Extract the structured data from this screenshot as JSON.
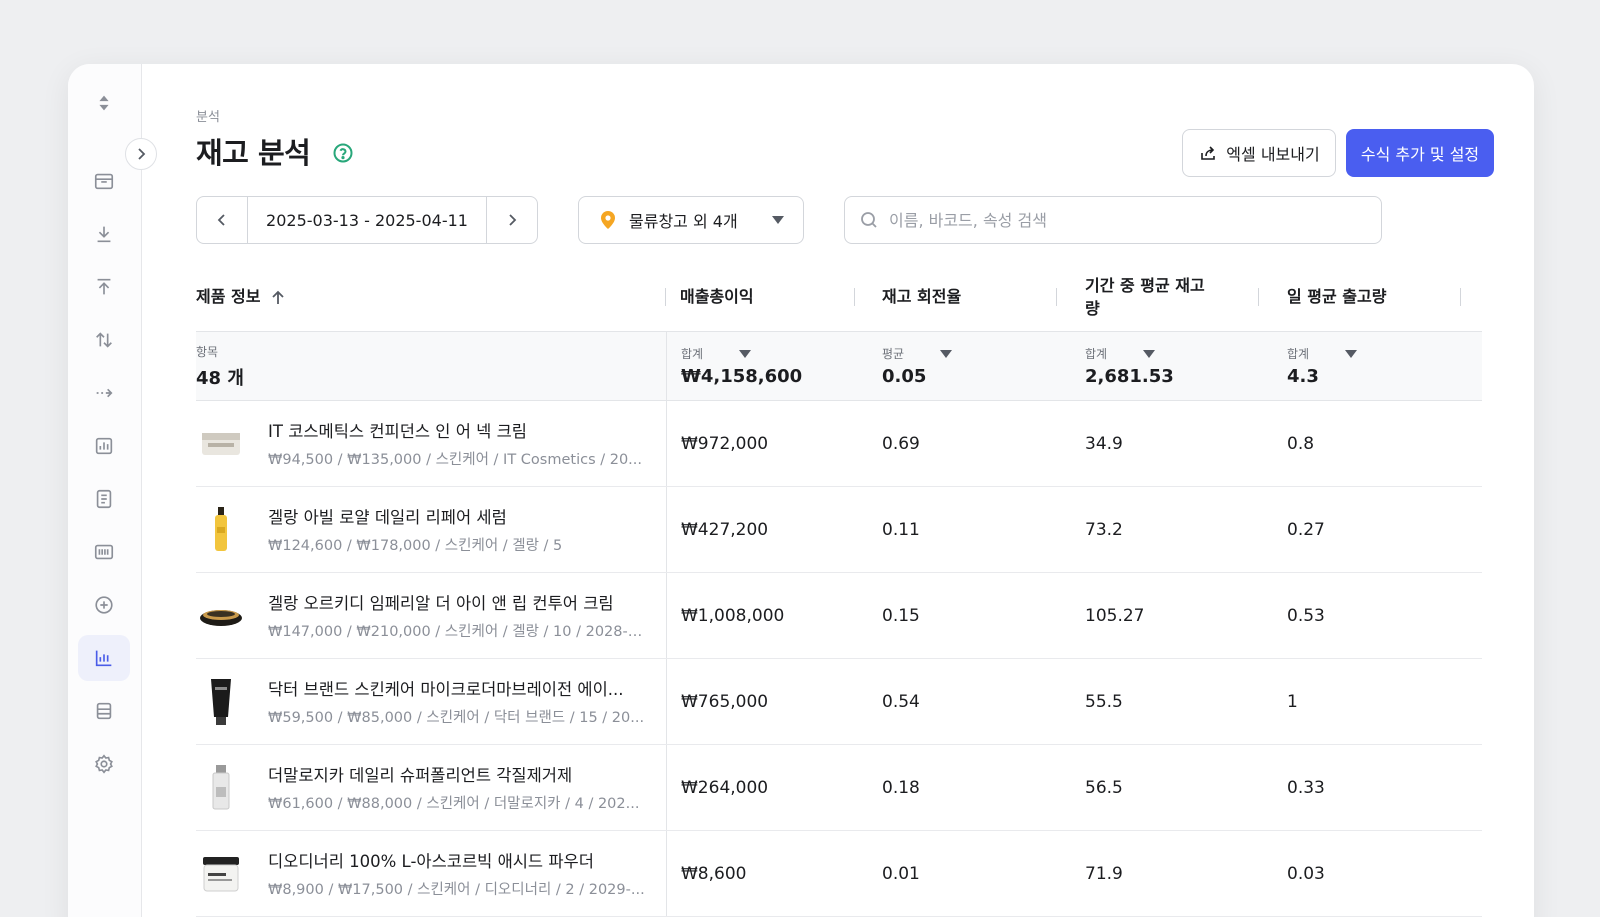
{
  "breadcrumb": "분석",
  "title": "재고 분석",
  "buttons": {
    "export": "엑셀 내보내기",
    "formula": "수식 추가 및 설정"
  },
  "filters": {
    "date_range": "2025-03-13 - 2025-04-11",
    "warehouse": "물류창고 외 4개",
    "search_placeholder": "이름, 바코드, 속성 검색"
  },
  "columns": [
    "제품 정보",
    "매출총이익",
    "재고 회전율",
    "기간 중 평균 재고량",
    "일 평균 출고량"
  ],
  "summary": {
    "items_label": "항목",
    "items_value": "48 개",
    "cells": [
      {
        "label": "합계",
        "value": "₩4,158,600"
      },
      {
        "label": "평균",
        "value": "0.05"
      },
      {
        "label": "합계",
        "value": "2,681.53"
      },
      {
        "label": "합계",
        "value": "4.3"
      }
    ]
  },
  "rows": [
    {
      "name": "IT 코스메틱스 컨피던스 인 어 넥 크림",
      "meta": "₩94,500 / ₩135,000 / 스킨케어 / IT Cosmetics / 20...",
      "profit": "₩972,000",
      "turnover": "0.69",
      "avg_stock": "34.9",
      "daily_out": "0.8"
    },
    {
      "name": "겔랑 아빌 로얄 데일리 리페어 세럼",
      "meta": "₩124,600 / ₩178,000 / 스킨케어 / 겔랑 / 5",
      "profit": "₩427,200",
      "turnover": "0.11",
      "avg_stock": "73.2",
      "daily_out": "0.27"
    },
    {
      "name": "겔랑 오르키디 임페리알 더 아이 앤 립 컨투어 크림",
      "meta": "₩147,000 / ₩210,000 / 스킨케어 / 겔랑 / 10 / 2028-0...",
      "profit": "₩1,008,000",
      "turnover": "0.15",
      "avg_stock": "105.27",
      "daily_out": "0.53"
    },
    {
      "name": "닥터 브랜드 스킨케어 마이크로더마브레이전 에이...",
      "meta": "₩59,500 / ₩85,000 / 스킨케어 / 닥터 브랜드 / 15 / 20...",
      "profit": "₩765,000",
      "turnover": "0.54",
      "avg_stock": "55.5",
      "daily_out": "1"
    },
    {
      "name": "더말로지카 데일리 슈퍼폴리언트 각질제거제",
      "meta": "₩61,600 / ₩88,000 / 스킨케어 / 더말로지카 / 4 / 202...",
      "profit": "₩264,000",
      "turnover": "0.18",
      "avg_stock": "56.5",
      "daily_out": "0.33"
    },
    {
      "name": "디오디너리 100% L-아스코르빅 애시드 파우더",
      "meta": "₩8,900 / ₩17,500 / 스킨케어 / 디오디너리 / 2 / 2029-...",
      "profit": "₩8,600",
      "turnover": "0.01",
      "avg_stock": "71.9",
      "daily_out": "0.03"
    }
  ],
  "colors": {
    "accent": "#4a5ef0",
    "help": "#28a77a",
    "pin": "#f5a623"
  }
}
